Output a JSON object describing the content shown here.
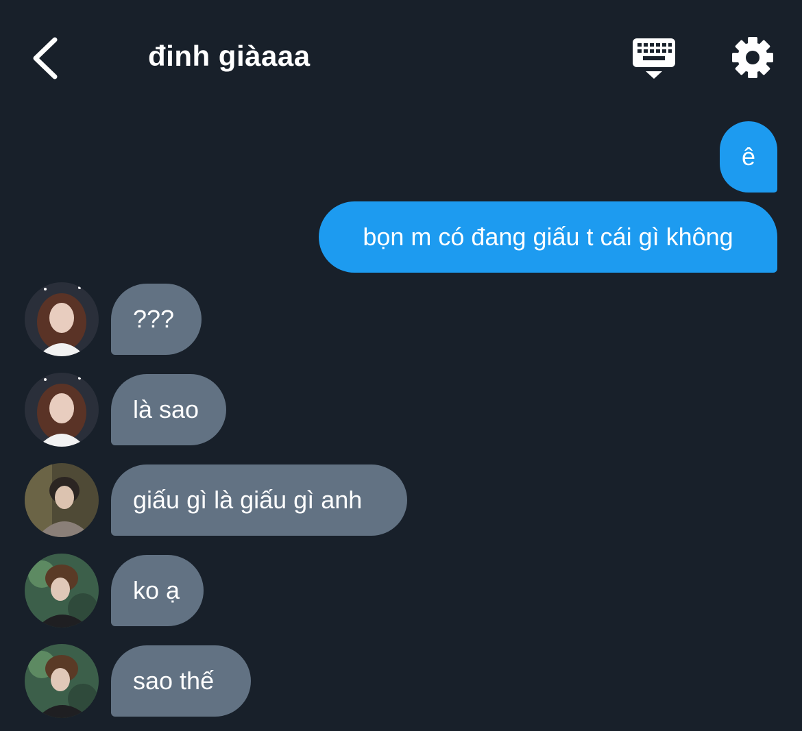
{
  "header": {
    "title": "đinh giàaaa",
    "back_icon": "chevron-left-icon",
    "keyboard_icon": "keyboard-icon",
    "settings_icon": "gear-icon"
  },
  "colors": {
    "background": "#18202a",
    "sent_bubble": "#1d9bf0",
    "received_bubble": "#627283",
    "text": "#ffffff"
  },
  "messages": [
    {
      "direction": "sent",
      "text": "ê"
    },
    {
      "direction": "sent",
      "text": "bọn m có đang giấu t cái gì không"
    },
    {
      "direction": "received",
      "text": "???",
      "avatar": "avatar-1"
    },
    {
      "direction": "received",
      "text": "là sao",
      "avatar": "avatar-1"
    },
    {
      "direction": "received",
      "text": "giấu gì là giấu gì anh",
      "avatar": "avatar-2"
    },
    {
      "direction": "received",
      "text": "ko ạ",
      "avatar": "avatar-3"
    },
    {
      "direction": "received",
      "text": "sao thế",
      "avatar": "avatar-3"
    }
  ]
}
